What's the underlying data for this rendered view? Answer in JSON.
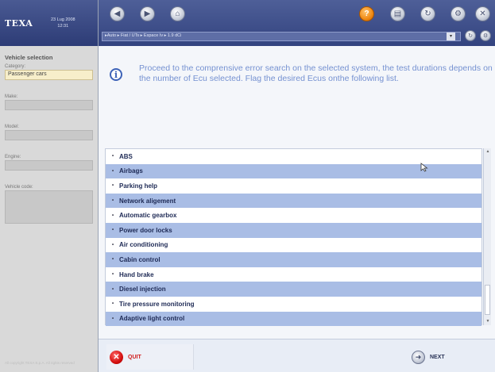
{
  "brand": {
    "logo": "TEXA",
    "date": "23 Lug 2008",
    "time": "12:31"
  },
  "sidebar": {
    "title": "Vehicle selection",
    "fields": [
      {
        "label": "Category:",
        "value": "Passenger cars"
      },
      {
        "label": "Make:",
        "value": ""
      },
      {
        "label": "Model:",
        "value": ""
      },
      {
        "label": "Engine:",
        "value": ""
      },
      {
        "label": "Vehicle code:",
        "value": ""
      }
    ],
    "copyright": "All copyright TEXA S.p.A. All rights reserved"
  },
  "toolbar": {
    "address": "▸Auto ▸ Fiat / UTs ▸ Espace Iv ▸ 1.9 dCi",
    "icons": [
      "back-icon",
      "forward-icon",
      "home-icon",
      "help-icon",
      "print-icon",
      "refresh-icon",
      "settings-icon",
      "close-icon"
    ],
    "help_color": "#f08a14"
  },
  "info": {
    "text": "Proceed to the comprensive error search on the selected system, the test durations depends on the number of Ecu selected. Flag the desired Ecus onthe following list."
  },
  "systems": [
    "ABS",
    "Airbags",
    "Parking help",
    "Network aligement",
    "Automatic gearbox",
    "Power door locks",
    "Air conditioning",
    "Cabin control",
    "Hand brake",
    "Diesel injection",
    "Tire pressure monitoring",
    "Adaptive light control"
  ],
  "buttons": {
    "quit": "QUIT",
    "next": "NEXT"
  },
  "colors": {
    "accent": "#33437f",
    "row_alt": "#a9bde5",
    "info_text": "#7591d1",
    "quit": "#d40e0e"
  }
}
